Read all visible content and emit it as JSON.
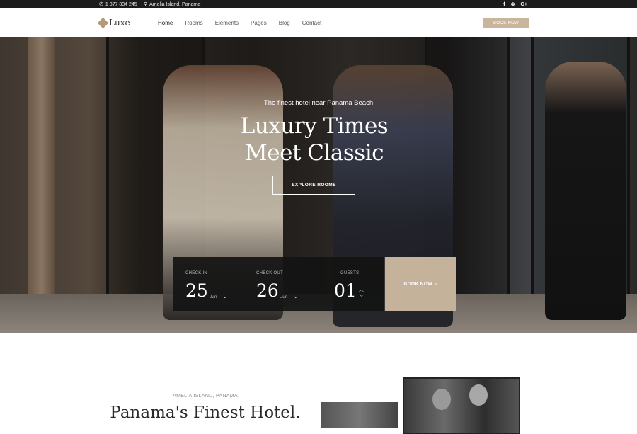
{
  "topbar": {
    "phone": "1 877 834 245",
    "address": "Amelia Island, Panama",
    "social": [
      "f",
      "⊛",
      "G+"
    ]
  },
  "nav": {
    "logo": "Luxe",
    "items": [
      "Home",
      "Rooms",
      "Elements",
      "Pages",
      "Blog",
      "Contact"
    ],
    "active": "Home",
    "book_label": "BOOK NOW"
  },
  "hero": {
    "subtitle": "The finest hotel near Panama Beach",
    "title_line1": "Luxury Times",
    "title_line2": "Meet Classic",
    "cta": "EXPLORE ROOMS"
  },
  "booking": {
    "check_in": {
      "label": "CHECK IN",
      "day": "25",
      "month": "Jun"
    },
    "check_out": {
      "label": "CHECK OUT",
      "day": "26",
      "month": "Jun"
    },
    "guests": {
      "label": "GUESTS",
      "value": "01"
    },
    "book_label": "BOOK NOW"
  },
  "intro": {
    "location": "AMELIA ISLAND, PANAMA",
    "heading": "Panama's Finest Hotel."
  },
  "colors": {
    "accent": "#c5b29a",
    "topbar": "#1c1c1c"
  }
}
